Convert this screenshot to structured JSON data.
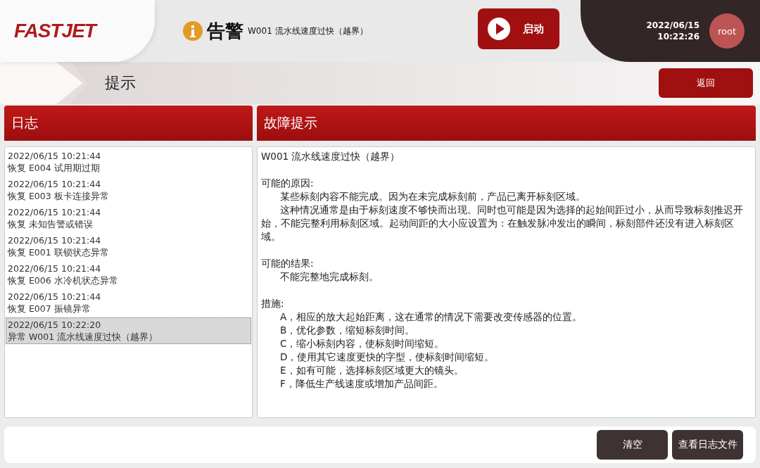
{
  "header": {
    "logo": "FASTJET",
    "alert_label": "告警",
    "alert_message": "W001 流水线速度过快（越界）",
    "start_button": "启动",
    "date": "2022/06/15",
    "time": "10:22:26",
    "user": "root"
  },
  "page": {
    "title": "提示",
    "back_button": "返回"
  },
  "log": {
    "title": "日志",
    "entries": [
      {
        "time": "2022/06/15 10:21:44",
        "message": "恢复 E004 试用期过期",
        "selected": false
      },
      {
        "time": "2022/06/15 10:21:44",
        "message": "恢复 E003 板卡连接异常",
        "selected": false
      },
      {
        "time": "2022/06/15 10:21:44",
        "message": "恢复 未知告警或错误",
        "selected": false
      },
      {
        "time": "2022/06/15 10:21:44",
        "message": "恢复 E001 联锁状态异常",
        "selected": false
      },
      {
        "time": "2022/06/15 10:21:44",
        "message": "恢复 E006 水冷机状态异常",
        "selected": false
      },
      {
        "time": "2022/06/15 10:21:44",
        "message": "恢复 E007 振镜异常",
        "selected": false
      },
      {
        "time": "2022/06/15 10:22:20",
        "message": "异常 W001 流水线速度过快（越界）",
        "selected": true
      }
    ]
  },
  "fault": {
    "title": "故障提示",
    "code_line": "W001 流水线速度过快（越界）",
    "sections": [
      {
        "heading": "可能的原因:",
        "paragraphs": [
          "某些标刻内容不能完成。因为在未完成标刻前，产品已离开标刻区域。",
          "这种情况通常是由于标刻速度不够快而出现。同时也可能是因为选择的起始间距过小，从而导致标刻推迟开始，不能完整利用标刻区域。起动间距的大小应设置为：在触发脉冲发出的瞬间，标刻部件还没有进入标刻区域。"
        ]
      },
      {
        "heading": "可能的结果:",
        "paragraphs": [
          "不能完整地完成标刻。"
        ]
      },
      {
        "heading": "措施:",
        "paragraphs": [
          "A，相应的放大起始距离，这在通常的情况下需要改变传感器的位置。",
          "B，优化参数，缩短标刻时间。",
          "C，缩小标刻内容，使标刻时间缩短。",
          "D，使用其它速度更快的字型，使标刻时间缩短。",
          "E，如有可能，选择标刻区域更大的镜头。",
          "F，降低生产线速度或增加产品间距。"
        ]
      }
    ]
  },
  "footer": {
    "buttons": [
      "清空",
      "查看日志文件"
    ]
  }
}
